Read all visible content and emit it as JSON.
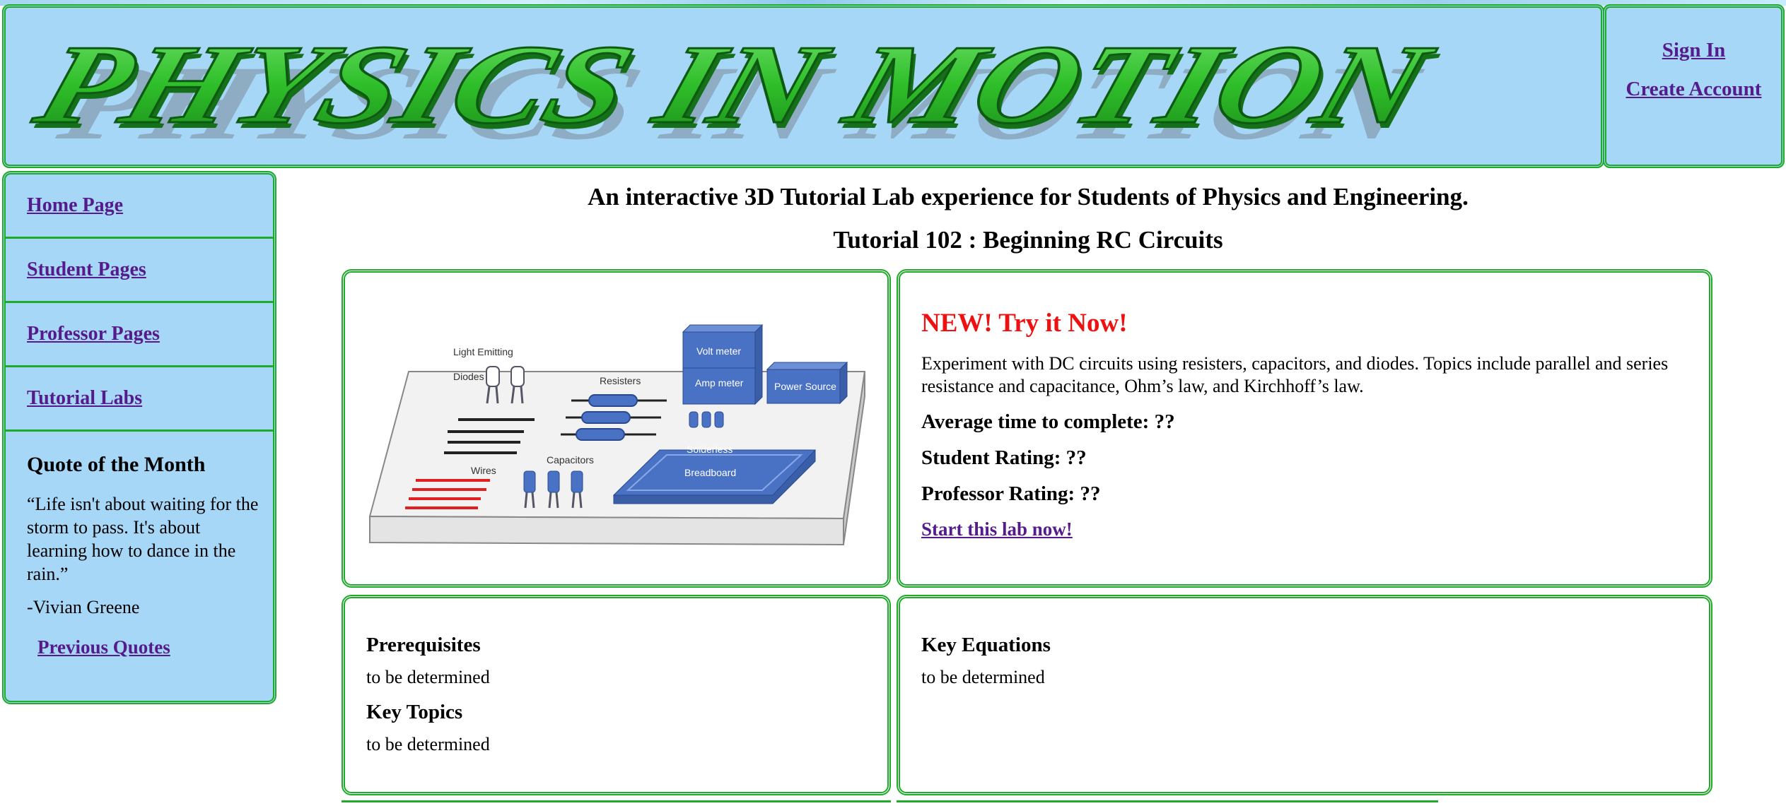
{
  "header": {
    "logo_text": "PHYSICS IN MOTION",
    "sign_in": "Sign In",
    "create_account": "Create Account"
  },
  "sidebar": {
    "items": [
      {
        "label": "Home Page"
      },
      {
        "label": "Student Pages"
      },
      {
        "label": "Professor Pages"
      },
      {
        "label": "Tutorial Labs"
      }
    ],
    "quote_title": "Quote of the Month",
    "quote_text": "“Life isn't about waiting for the storm to pass. It's about learning how to dance in the rain.”",
    "quote_author": "-Vivian Greene",
    "previous_quotes": "Previous Quotes"
  },
  "main": {
    "headline": "An interactive 3D Tutorial Lab experience for Students of Physics and Engineering.",
    "tutorial_title": "Tutorial 102 : Beginning RC Circuits",
    "illustration": {
      "led_label_1": "Light Emitting",
      "led_label_2": "Diodes",
      "resisters_label": "Resisters",
      "voltmeter_label": "Volt meter",
      "ammeter_label": "Amp meter",
      "power_label": "Power Source",
      "wires_label": "Wires",
      "capacitors_label": "Capacitors",
      "breadboard_label_1": "Solderless",
      "breadboard_label_2": "Breadboard"
    },
    "promo": {
      "title": "NEW! Try it Now!",
      "description": "Experiment with DC circuits using resisters, capacitors, and diodes. Topics include parallel and series resistance and capacitance, Ohm’s law, and Kirchhoff’s law.",
      "avg_time": "Average time to complete: ??",
      "student_rating": "Student Rating: ??",
      "professor_rating": "Professor Rating: ??",
      "start_link": "Start this lab now!"
    },
    "prerequisites_title": "Prerequisites",
    "prerequisites_text": "to be determined",
    "key_topics_title": "Key Topics",
    "key_topics_text": "to be determined",
    "key_equations_title": "Key Equations",
    "key_equations_text": "to be determined"
  },
  "colors": {
    "banner_blue": "#a7d7f7",
    "border_green": "#1faa2a",
    "logo_green": "#2fbf2a",
    "link_purple": "#551a8b",
    "promo_red": "#ee1111",
    "component_blue": "#4a72c4"
  }
}
